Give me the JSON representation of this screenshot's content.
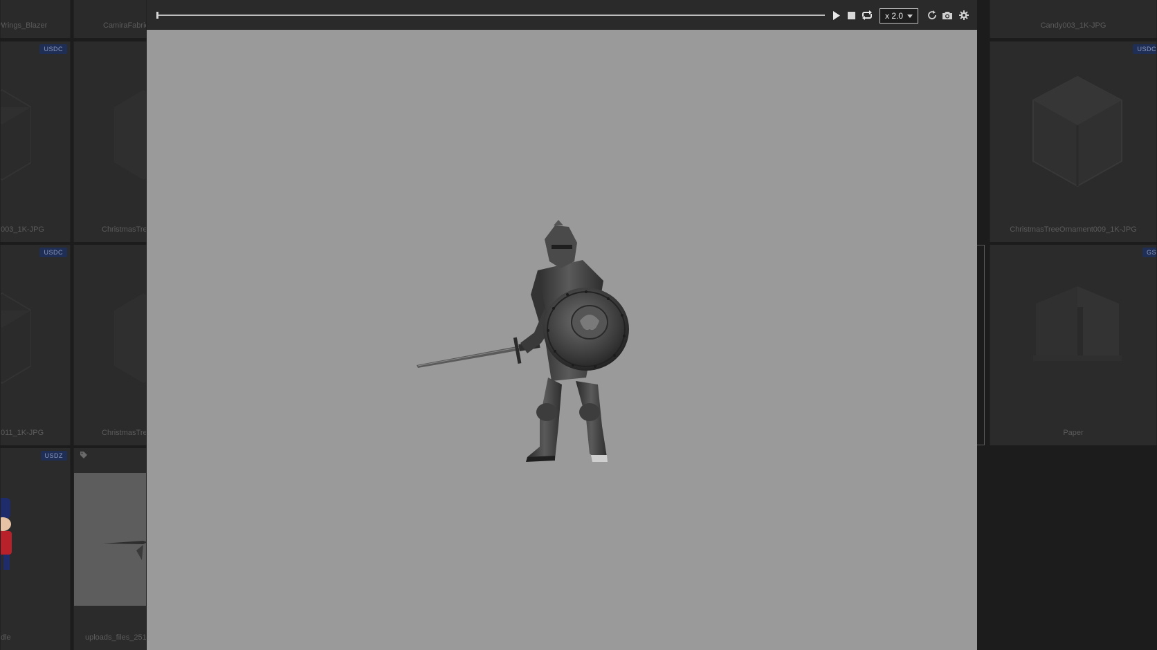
{
  "background_grid": {
    "row1_names": [
      "Wrings_Blazer",
      "CamiraFabric",
      "Candy003_1K-JPG"
    ],
    "row2_names": [
      "003_1K-JPG",
      "ChristmasTre",
      "ChristmasTreeOrnament009_1K-JPG"
    ],
    "row2_badges": [
      "USDC",
      "USDC"
    ],
    "row3_names": [
      "011_1K-JPG",
      "ChristmasTre",
      "Paper"
    ],
    "row3_badges": [
      "USDC",
      "GS"
    ],
    "row4_names": [
      "dle",
      "uploads_files_251"
    ],
    "row4_badges": [
      "USDZ"
    ]
  },
  "viewer": {
    "toolbar": {
      "play_icon": "play-icon",
      "stop_icon": "stop-icon",
      "loop_icon": "loop-icon",
      "speed_value": "x 2.0",
      "reset_icon": "refresh-icon",
      "screenshot_icon": "camera-icon",
      "settings_icon": "gear-icon"
    },
    "timeline_progress": 0.0,
    "model": "armored-knight-with-sword-and-shield"
  },
  "colors": {
    "viewer_bg": "#9a9a9a",
    "toolbar_bg": "#2a2a2a",
    "badge_bg": "#1f2e55"
  }
}
